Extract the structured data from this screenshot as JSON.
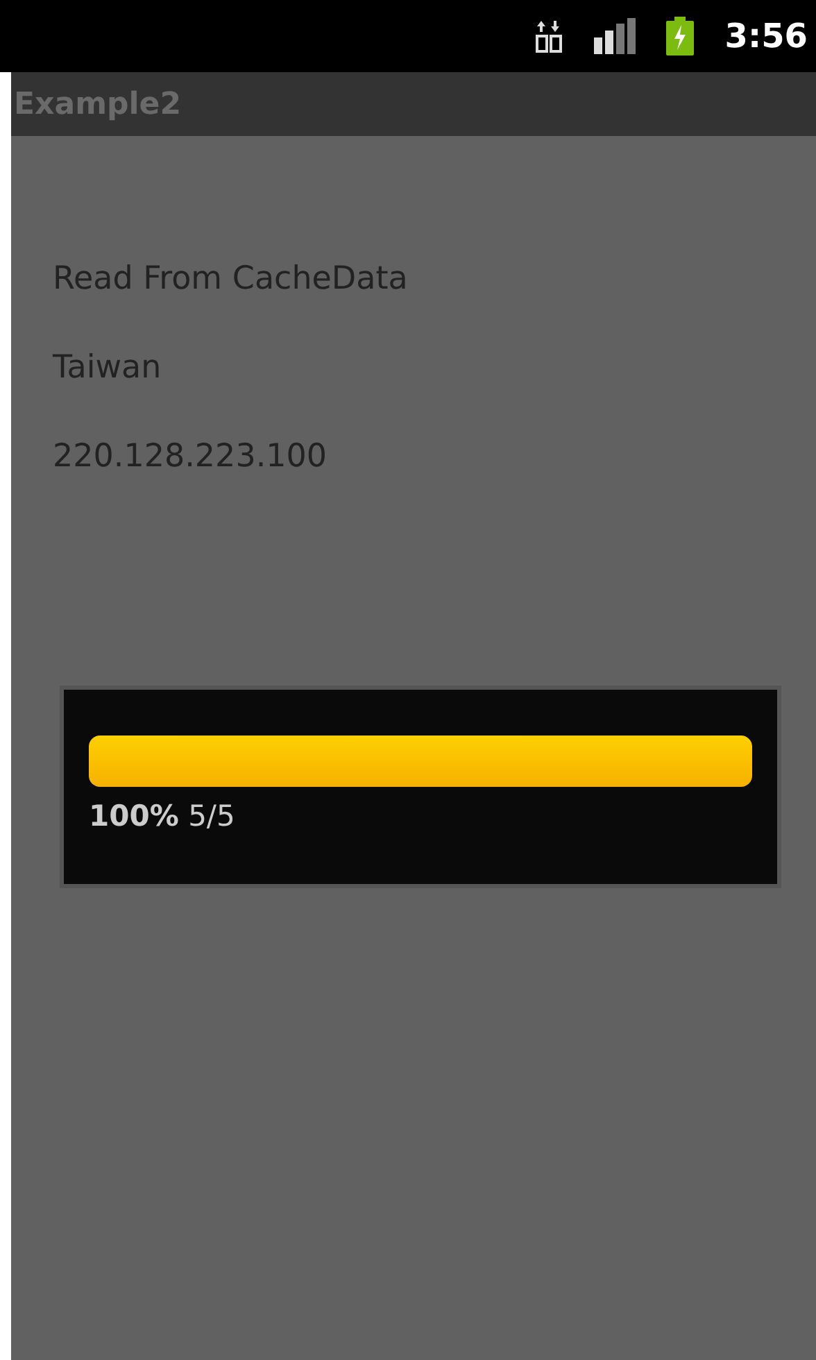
{
  "status_bar": {
    "time": "3:56"
  },
  "title_bar": {
    "title": "Example2"
  },
  "content": {
    "lines": [
      "Read From CacheData",
      "Taiwan",
      "220.128.223.100"
    ]
  },
  "progress_dialog": {
    "caption": "**100%** 5/5"
  }
}
